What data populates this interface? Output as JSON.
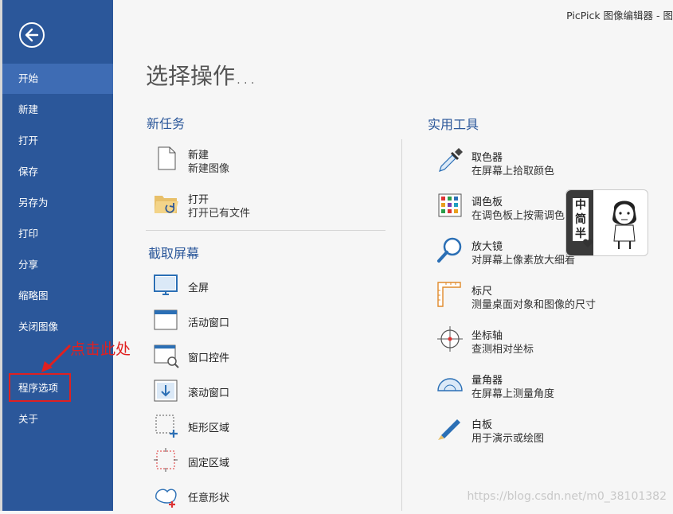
{
  "app_title": "PicPick 图像编辑器 - 图",
  "sidebar": {
    "items": [
      {
        "label": "开始"
      },
      {
        "label": "新建"
      },
      {
        "label": "打开"
      },
      {
        "label": "保存"
      },
      {
        "label": "另存为"
      },
      {
        "label": "打印"
      },
      {
        "label": "分享"
      },
      {
        "label": "缩略图"
      },
      {
        "label": "关闭图像"
      },
      {
        "label": "程序选项"
      },
      {
        "label": "关于"
      }
    ]
  },
  "annotation": {
    "text": "点击此处"
  },
  "main": {
    "title": "选择操作...",
    "new_task": {
      "heading": "新任务",
      "items": [
        {
          "title": "新建",
          "desc": "新建图像"
        },
        {
          "title": "打开",
          "desc": "打开已有文件"
        }
      ]
    },
    "capture": {
      "heading": "截取屏幕",
      "items": [
        {
          "label": "全屏"
        },
        {
          "label": "活动窗口"
        },
        {
          "label": "窗口控件"
        },
        {
          "label": "滚动窗口"
        },
        {
          "label": "矩形区域"
        },
        {
          "label": "固定区域"
        },
        {
          "label": "任意形状"
        }
      ]
    },
    "tools": {
      "heading": "实用工具",
      "items": [
        {
          "title": "取色器",
          "desc": "在屏幕上拾取颜色"
        },
        {
          "title": "调色板",
          "desc": "在调色板上按需调色"
        },
        {
          "title": "放大镜",
          "desc": "对屏幕上像素放大细看"
        },
        {
          "title": "标尺",
          "desc": "测量桌面对象和图像的尺寸"
        },
        {
          "title": "坐标轴",
          "desc": "查测相对坐标"
        },
        {
          "title": "量角器",
          "desc": "在屏幕上测量角度"
        },
        {
          "title": "白板",
          "desc": "用于演示或绘图"
        }
      ]
    }
  },
  "sticker": {
    "text": "中简半"
  },
  "watermark": "https://blog.csdn.net/m0_38101382",
  "colors": {
    "sidebar": "#2b579a",
    "sidebar_active": "#3e6cb4",
    "accent": "#2b579a",
    "annotation": "#e02020"
  }
}
